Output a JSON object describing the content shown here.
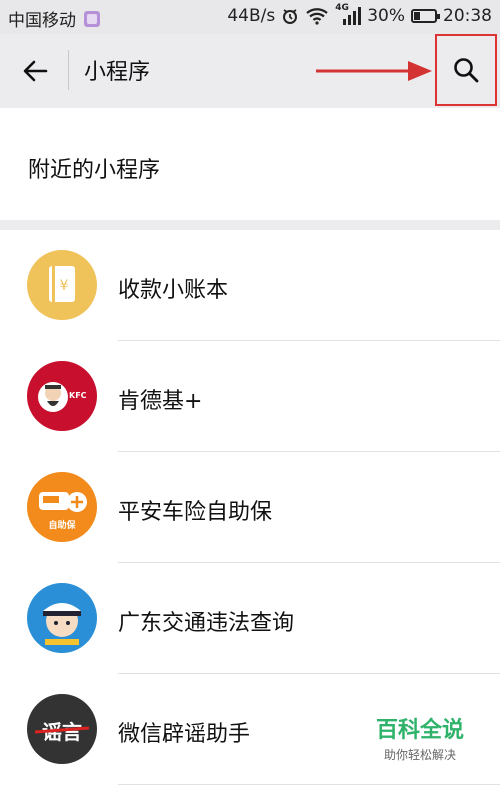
{
  "status_bar": {
    "carrier": "中国移动",
    "net_speed": "44B/s",
    "network_type": "4G",
    "battery": "30%",
    "battery_level": 0.3,
    "time": "20:38"
  },
  "app_bar": {
    "title": "小程序",
    "back_icon": "arrow-left-icon",
    "search_icon": "search-icon",
    "highlight_color": "#d33333"
  },
  "nearby": {
    "label": "附近的小程序"
  },
  "mini_programs": [
    {
      "name": "收款小账本"
    },
    {
      "name": "肯德基+",
      "icon_text": "KFC"
    },
    {
      "name": "平安车险自助保",
      "icon_text": "自助保"
    },
    {
      "name": "广东交通违法查询"
    },
    {
      "name": "微信辟谣助手",
      "icon_text": "谣言"
    }
  ],
  "watermark": {
    "title": "百科全说",
    "subtitle": "助你轻松解决"
  }
}
